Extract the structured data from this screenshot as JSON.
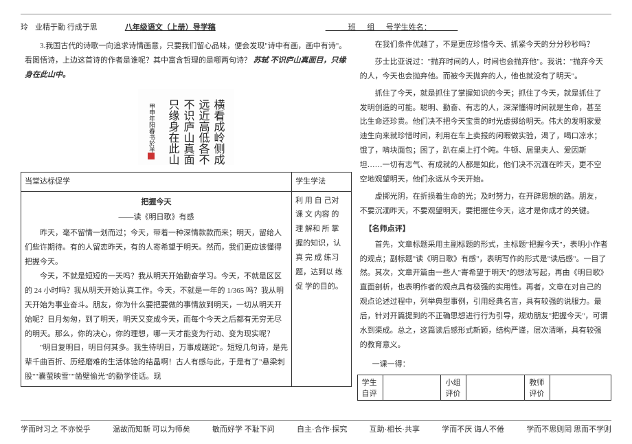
{
  "header": {
    "hintLeft": "玲",
    "motto": "业精于勤  行成于思",
    "title": "八年级语文（上册）导学稿",
    "blanks": "______班___组___号学生姓名：_______"
  },
  "poem": {
    "question": "3.我国古代的诗歌一向追求诗情画意，只要我们留心品味，便会发现\"诗中有画，画中有诗\"。看图悟诗，上边这首诗的作者是谁呢？其中富含哲理的是哪两句诗？",
    "answer": "苏轼  不识庐山真面目，只缘身在此山中。"
  },
  "calligraphy": {
    "c1": "横看成岭侧成峰",
    "c2": "远近高低各不同",
    "c3": "不识庐山真面目",
    "c4": "只缘身在此山中",
    "sig": "甲申年阳春书於羊"
  },
  "table": {
    "leftHdr": "当堂达标促学",
    "rightHdr": "学生学法",
    "essayTitle": "把握今天",
    "essaySubtitle": "——读《明日歌》有感",
    "p1": "昨天，毫不留情一划而过；今天，带着一种深情款款而来；明天，留给人们些许期待。有的人留恋昨天，有的人寄希望于明天。然而，我们更应该懂得把握今天。",
    "p2": "今天，不就是短短的一天吗？我从明天开始勤奋学习。今天，不就是区区的 24 小时吗？我从明天开始认真工作。今天，不就是一年的 1/365 吗？我从明天开始为事业奋斗。朋友，你为什么要把要做的事情放到明天，一切从明天开始呢？日月匆匆，到了明天，明天又变成今天，而每个今天之后都有无穷无尽的明天。那么，你的决心，你的理想，哪一天才能变为行动、变为现实呢？",
    "p3": "\"明日复明日，明日何其多。我生待明日，万事成蹉跎\"。短短几句诗，是先辈千曲百折、历经磨难的生活体验的结晶啊！古人有感与此，于是有了\"悬梁刺股\"\"囊萤映雪\"\"凿壁偷光\"的勤学佳话。现",
    "method": "利 用 自 己对 课 文 内容 的 理 解和 所 掌 握的知识，认真 完 成 练习题，达到以 练 促 学的目的。"
  },
  "right": {
    "p1": "在我们条件优越了，不是更应珍惜今天、抓紧今天的分分秒秒吗？",
    "p2": "莎士比亚说过：\"抛弃时间的人，时间也会抛弃他\"。我说：\"抛弃今天的人，今天也会抛弃他。而被今天抛弃的人，他也就没有了明天\"。",
    "p3": "抓住了今天，就是抓住了掌握知识的今天；抓住了今天，就是抓住了发明创造的可能。聪明、勤奋、有志的人，深深懂得时间就是生命，甚至比生命还珍贵。他们决不把今天宝贵的时光虚掷给明天。伟大的发明家爱迪生向来就珍惜时间，利用在车上卖报的闲暇做实验，渴了，喝口凉水；饿了，啃块面包；困了，趴在桌上打个盹。牛顿、居里夫人、爱因斯坦……一切有志气、有成就的人都是如此，他们决不沉湎在昨天，更不空空地观望明天，他们永远从今天开始。",
    "p4": "虚掷光阴，在折损着生命的光；及时努力，在开辟思想的路。朋友，不要沉湎昨天，不要观望明天，要把握住今天，这才是你成才的关键。",
    "commentTitle": "【名师点评】",
    "comment": "首先，文章标题采用主副标题的形式，主标题\"把握今天\"，表明小作者的观点；副标题\"读《明日歌》有感\"，表明写作的形式是\"读后感\"。一目了然。其次，文章开篇由一些人\"寄希望于明天\"的想法写起，再由《明日歌》直面剖析，也表明作者的观点具有极强的实用性。再者，文章在对自己的观点论述过程中，列举典型事例，引用经典名言，具有较强的说服力。最后，针对开篇提到的不正确思想进行行为引导，规劝朋友\"把握今天\"，可谓水到渠成。总之，这篇读后感形式新颖，结构严谨，层次清晰，具有较强的教育意义。",
    "lesson": "一课一得："
  },
  "eval": {
    "c1": "学生自评",
    "c2": "小组评价",
    "c3": "教师评价"
  },
  "footer": {
    "f1": "学而时习之  不亦悦乎",
    "f2": "温故而知新  可以为师矣",
    "f3": "敏而好学  不耻下问",
    "f4": "自主·合作·探究",
    "f5": "互助·相长·共享",
    "f6": "学而不厌  诲人不倦",
    "f7": "学而不思则罔  思而不学则"
  }
}
